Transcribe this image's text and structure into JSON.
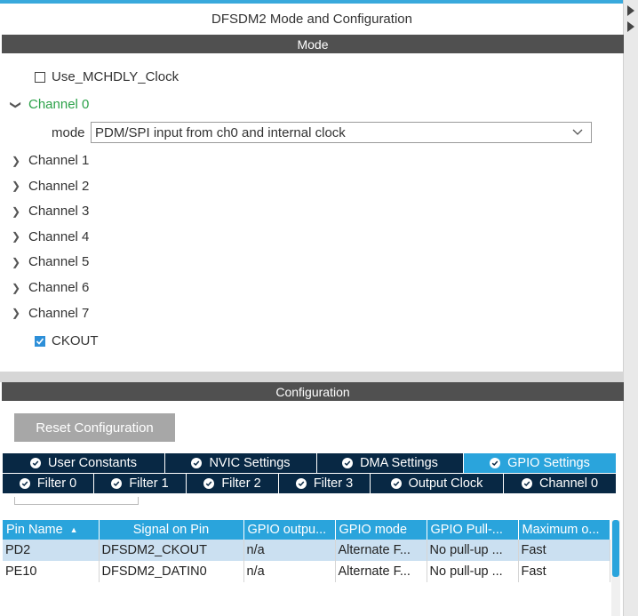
{
  "panel": {
    "title": "DFSDM2 Mode and Configuration"
  },
  "mode": {
    "header": "Mode",
    "use_clock_label": "Use_MCHDLY_Clock",
    "use_clock_checked": false,
    "channel0": {
      "label": "Channel 0",
      "mode_label": "mode",
      "mode_value": "PDM/SPI input from ch0 and internal clock"
    },
    "channels": [
      "Channel 1",
      "Channel 2",
      "Channel 3",
      "Channel 4",
      "Channel 5",
      "Channel 6",
      "Channel 7"
    ],
    "ckout_label": "CKOUT",
    "ckout_checked": true
  },
  "configuration": {
    "header": "Configuration",
    "reset_label": "Reset Configuration",
    "tabs_row1": [
      "User Constants",
      "NVIC Settings",
      "DMA Settings",
      "GPIO Settings"
    ],
    "tabs_row2": [
      "Filter 0",
      "Filter 1",
      "Filter 2",
      "Filter 3",
      "Output Clock",
      "Channel 0"
    ],
    "active_tab": "GPIO Settings",
    "table": {
      "columns": [
        "Pin Name",
        "Signal on Pin",
        "GPIO outpu...",
        "GPIO mode",
        "GPIO Pull-...",
        "Maximum o..."
      ],
      "rows": [
        [
          "PD2",
          "DFSDM2_CKOUT",
          "n/a",
          "Alternate F...",
          "No pull-up ...",
          "Fast"
        ],
        [
          "PE10",
          "DFSDM2_DATIN0",
          "n/a",
          "Alternate F...",
          "No pull-up ...",
          "Fast"
        ]
      ]
    }
  },
  "colors": {
    "accent": "#2aa4dc",
    "tab_dark": "#082844",
    "section_bar": "#505050",
    "active_channel": "#2da24a"
  }
}
